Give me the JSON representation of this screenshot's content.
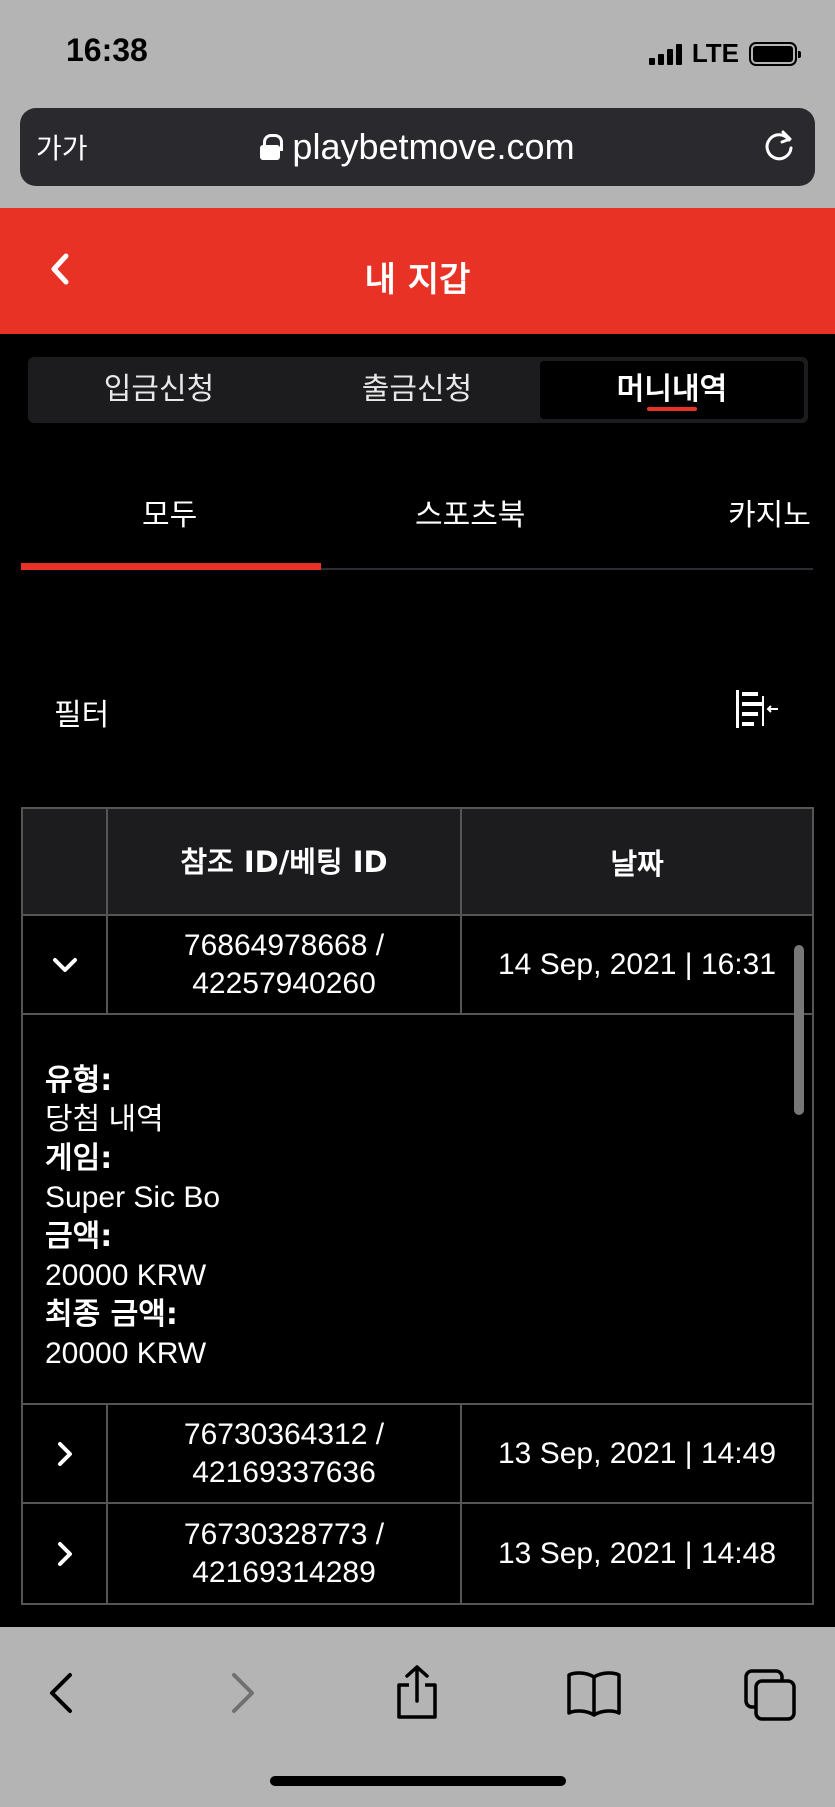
{
  "status_bar": {
    "time": "16:38",
    "network": "LTE"
  },
  "browser": {
    "text_size_label": "가가",
    "url": "playbetmove.com"
  },
  "header": {
    "title": "내 지갑"
  },
  "top_tabs": [
    {
      "label": "입금신청",
      "active": false
    },
    {
      "label": "출금신청",
      "active": false
    },
    {
      "label": "머니내역",
      "active": true
    }
  ],
  "sub_tabs": [
    {
      "label": "모두",
      "active": true
    },
    {
      "label": "스포츠북",
      "active": false
    },
    {
      "label": "카지노",
      "active": false
    }
  ],
  "filter": {
    "label": "필터"
  },
  "table": {
    "columns": [
      "참조 ID/베팅 ID",
      "날짜"
    ],
    "rows": [
      {
        "ref_id": "76864978668 /",
        "bet_id": "42257940260",
        "date": "14 Sep, 2021 | 16:31",
        "expanded": true
      },
      {
        "ref_id": "76730364312 /",
        "bet_id": "42169337636",
        "date": "13 Sep, 2021 | 14:49",
        "expanded": false
      },
      {
        "ref_id": "76730328773 /",
        "bet_id": "42169314289",
        "date": "13 Sep, 2021 | 14:48",
        "expanded": false
      }
    ],
    "detail": {
      "type_label": "유형:",
      "type_value": "당첨 내역",
      "game_label": "게임:",
      "game_value": "Super Sic Bo",
      "amount_label": "금액:",
      "amount_value": "20000 KRW",
      "final_label": "최종 금액:",
      "final_value": "20000 KRW"
    }
  },
  "colors": {
    "accent": "#e83225",
    "background": "#000000",
    "chrome": "#b4b4b4"
  }
}
